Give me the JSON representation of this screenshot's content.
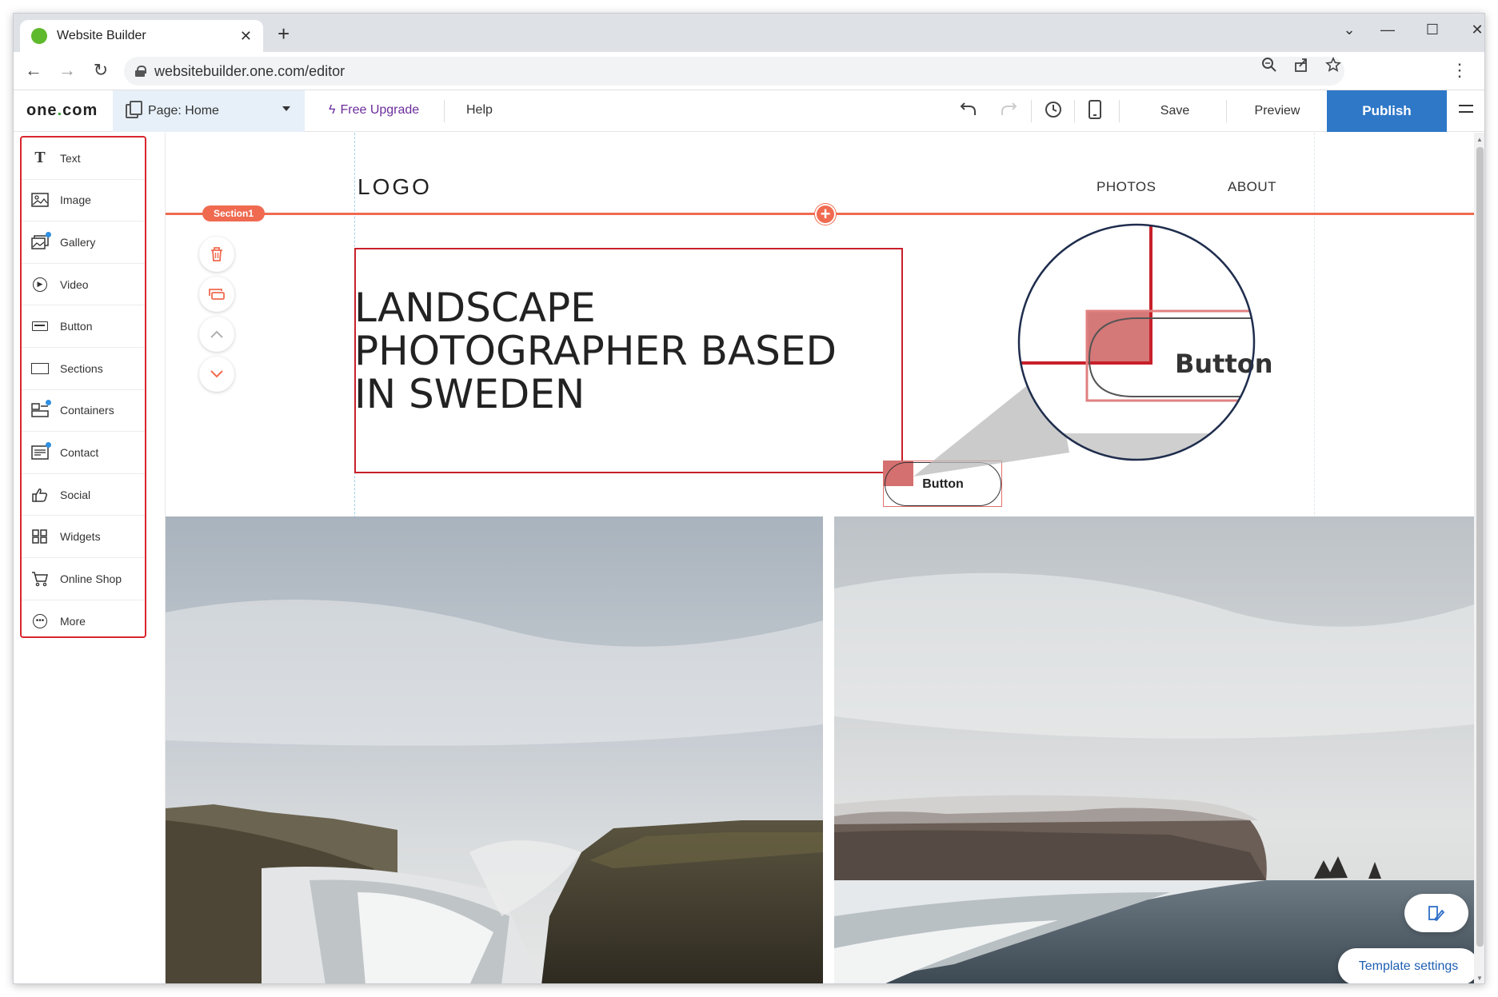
{
  "browser": {
    "tab_title": "Website Builder",
    "tab_close": "✕",
    "new_tab": "+",
    "url": "websitebuilder.one.com/editor",
    "window_controls": {
      "minimize": "—",
      "maximize": "☐",
      "close": "✕",
      "dropdown": "⌄"
    }
  },
  "toolbar": {
    "brand_prefix": "one",
    "brand_dot": ".",
    "brand_suffix": "com",
    "page_label": "Page: Home",
    "upgrade_label": "Free Upgrade",
    "help_label": "Help",
    "save_label": "Save",
    "preview_label": "Preview",
    "publish_label": "Publish",
    "colors": {
      "publish_bg": "#2f78c8",
      "upgrade_text": "#6b2d9c",
      "accent": "#f06a50"
    }
  },
  "elements_panel": {
    "items": [
      {
        "label": "Text",
        "icon": "text-icon"
      },
      {
        "label": "Image",
        "icon": "image-icon"
      },
      {
        "label": "Gallery",
        "icon": "gallery-icon",
        "badge": true
      },
      {
        "label": "Video",
        "icon": "video-icon"
      },
      {
        "label": "Button",
        "icon": "button-icon"
      },
      {
        "label": "Sections",
        "icon": "sections-icon"
      },
      {
        "label": "Containers",
        "icon": "containers-icon",
        "badge": true
      },
      {
        "label": "Contact",
        "icon": "contact-icon",
        "badge": true
      },
      {
        "label": "Social",
        "icon": "social-icon"
      },
      {
        "label": "Widgets",
        "icon": "widgets-icon"
      },
      {
        "label": "Online Shop",
        "icon": "cart-icon"
      },
      {
        "label": "More",
        "icon": "more-icon"
      }
    ]
  },
  "canvas": {
    "logo": "LOGO",
    "nav": [
      "PHOTOS",
      "ABOUT"
    ],
    "section_tag": "Section1",
    "heading": "LANDSCAPE PHOTOGRAPHER BASED IN SWEDEN",
    "button_label": "Button",
    "zoom_button_label": "Button",
    "template_settings": "Template settings"
  }
}
